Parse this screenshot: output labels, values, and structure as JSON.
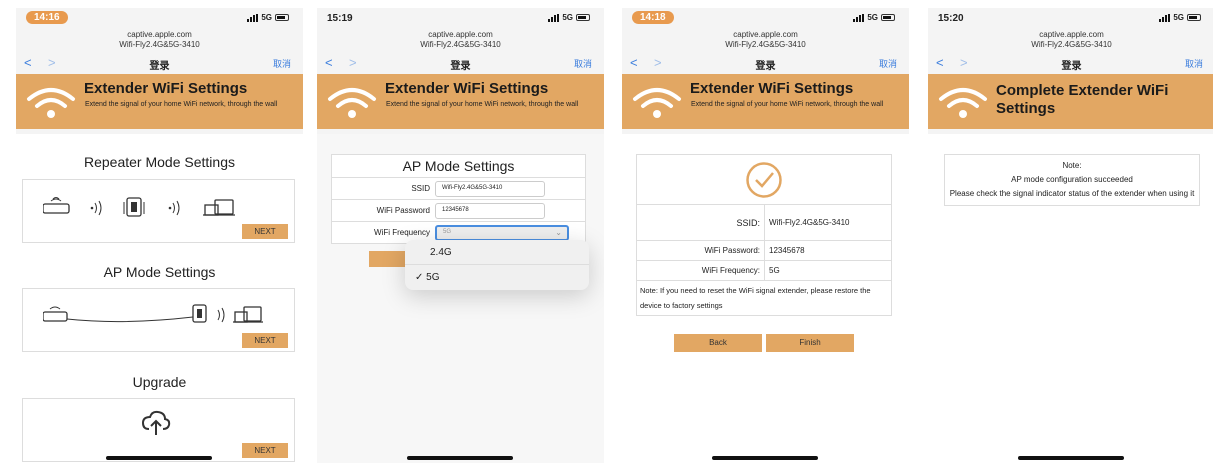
{
  "screens": [
    {
      "time": "14:16",
      "network": "5G",
      "url_line1": "captive.apple.com",
      "url_line2": "Wifi-Fly2.4G&5G-3410",
      "nav_title": "登录",
      "nav_cancel": "取消",
      "banner_title": "Extender WiFi Settings",
      "banner_subtitle": "Extend the signal of your home WiFi network, through the wall",
      "sections": [
        {
          "title": "Repeater Mode Settings",
          "next": "NEXT"
        },
        {
          "title": "AP Mode Settings",
          "next": "NEXT"
        },
        {
          "title": "Upgrade",
          "next": "NEXT"
        }
      ]
    },
    {
      "time": "15:19",
      "network": "5G",
      "url_line1": "captive.apple.com",
      "url_line2": "Wifi-Fly2.4G&5G-3410",
      "nav_title": "登录",
      "nav_cancel": "取消",
      "banner_title": "Extender WiFi Settings",
      "banner_subtitle": "Extend the signal of your home WiFi network, through the wall",
      "form_title": "AP Mode Settings",
      "ssid_label": "SSID",
      "ssid_value": "Wifi-Fly2.4G&5G-3410",
      "password_label": "WiFi Password",
      "password_value": "12345678",
      "frequency_label": "WiFi Frequency",
      "frequency_value": "5G",
      "dropdown_options": [
        "2.4G",
        "5G"
      ],
      "dropdown_checked": "✓"
    },
    {
      "time": "14:18",
      "network": "5G",
      "url_line1": "captive.apple.com",
      "url_line2": "Wifi-Fly2.4G&5G-3410",
      "nav_title": "登录",
      "nav_cancel": "取消",
      "banner_title": "Extender WiFi Settings",
      "banner_subtitle": "Extend the signal of your home WiFi network, through the wall",
      "ssid_label": "SSID:",
      "ssid_value": "Wifi-Fly2.4G&5G-3410",
      "password_label": "WiFi Password:",
      "password_value": "12345678",
      "frequency_label": "WiFi Frequency:",
      "frequency_value": "5G",
      "note": "Note: If you need to reset the WiFi signal extender, please restore the device to factory settings",
      "back": "Back",
      "finish": "Finish"
    },
    {
      "time": "15:20",
      "network": "5G",
      "url_line1": "captive.apple.com",
      "url_line2": "Wifi-Fly2.4G&5G-3410",
      "nav_title": "登录",
      "nav_cancel": "取消",
      "banner_title": "Complete Extender WiFi Settings",
      "note_title": "Note:",
      "note_line1": "AP mode configuration succeeded",
      "note_line2": "Please check the signal indicator status of the extender when using it"
    }
  ],
  "colors": {
    "accent": "#e2a763",
    "pill": "#e89a4e",
    "link": "#3b7ddd"
  }
}
